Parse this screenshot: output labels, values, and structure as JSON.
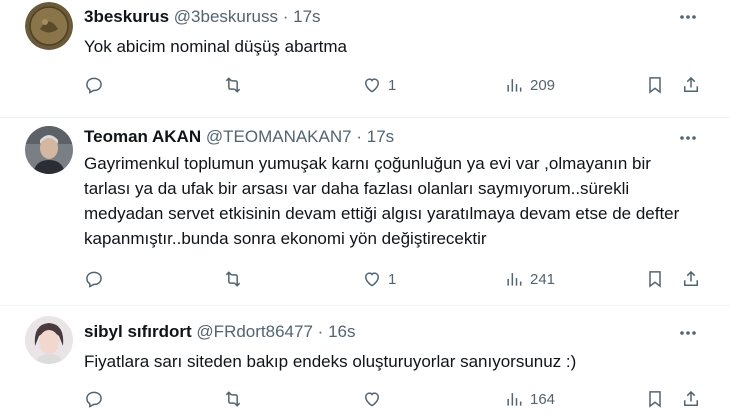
{
  "tweets": [
    {
      "name": "3beskurus",
      "handle": "@3beskuruss",
      "separator": "·",
      "time": "17s",
      "text": "Yok abicim nominal düşüş abartma",
      "reply_count": "",
      "retweet_count": "",
      "like_count": "1",
      "views": "209",
      "avatar_icon": "coin-avatar"
    },
    {
      "name": "Teoman AKAN",
      "handle": "@TEOMANAKAN7",
      "separator": "·",
      "time": "17s",
      "text": "Gayrimenkul toplumun yumuşak karnı çoğunluğun ya evi var ,olmayanın bir tarlası ya da ufak bir arsası var daha fazlası olanları saymıyorum..sürekli medyadan servet etkisinin devam ettiği algısı yaratılmaya devam etse de defter kapanmıştır..bunda sonra ekonomi yön değiştirecektir",
      "reply_count": "",
      "retweet_count": "",
      "like_count": "1",
      "views": "241",
      "avatar_icon": "person-avatar"
    },
    {
      "name": "sibyl sıfırdort",
      "handle": "@FRdort86477",
      "separator": "·",
      "time": "16s",
      "text": "Fiyatlara sarı siteden bakıp endeks oluşturuyorlar sanıyorsunuz :)",
      "reply_count": "",
      "retweet_count": "",
      "like_count": "",
      "views": "164",
      "avatar_icon": "person-avatar"
    }
  ],
  "colors": {
    "text": "#0f1419",
    "secondary": "#536471",
    "divider": "#eff3f4"
  }
}
